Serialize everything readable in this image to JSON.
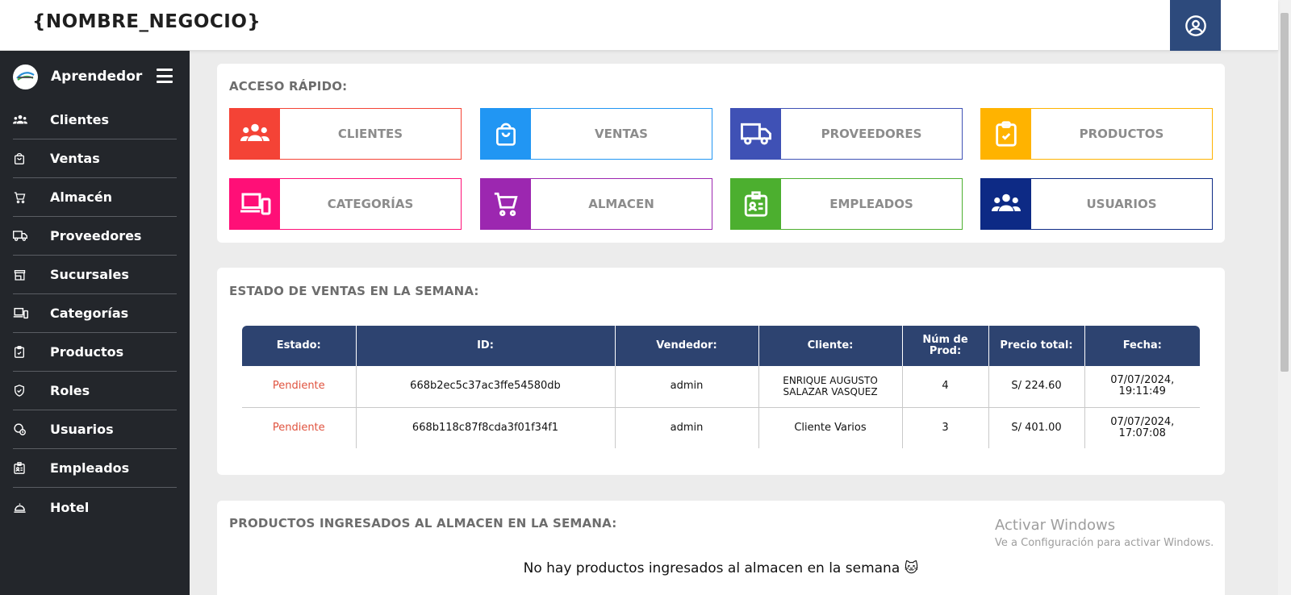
{
  "header": {
    "brand": "{NOMBRE_NEGOCIO}",
    "user_icon": "user-circle-icon"
  },
  "sidebar": {
    "title": "Aprendedor",
    "items": [
      {
        "label": "Clientes",
        "icon": "people-icon"
      },
      {
        "label": "Ventas",
        "icon": "shopping-bag-icon"
      },
      {
        "label": "Almacén",
        "icon": "cart-icon"
      },
      {
        "label": "Proveedores",
        "icon": "truck-icon"
      },
      {
        "label": "Sucursales",
        "icon": "store-icon"
      },
      {
        "label": "Categorías",
        "icon": "devices-icon"
      },
      {
        "label": "Productos",
        "icon": "clipboard-check-icon"
      },
      {
        "label": "Roles",
        "icon": "shield-check-icon"
      },
      {
        "label": "Usuarios",
        "icon": "user-clock-icon"
      },
      {
        "label": "Empleados",
        "icon": "badge-icon"
      },
      {
        "label": "Hotel",
        "icon": "bell-service-icon"
      }
    ]
  },
  "quick_access": {
    "title": "ACCESO RÁPIDO:",
    "tiles": [
      {
        "label": "CLIENTES",
        "color": "#f44336",
        "icon": "people-icon"
      },
      {
        "label": "VENTAS",
        "color": "#2196f3",
        "icon": "shopping-bag-icon"
      },
      {
        "label": "PROVEEDORES",
        "color": "#3f51b5",
        "icon": "truck-icon"
      },
      {
        "label": "PRODUCTOS",
        "color": "#ffb300",
        "icon": "clipboard-check-icon"
      },
      {
        "label": "CATEGORÍAS",
        "color": "#ff0f77",
        "icon": "devices-icon"
      },
      {
        "label": "ALMACEN",
        "color": "#9c27b0",
        "icon": "cart-icon"
      },
      {
        "label": "EMPLEADOS",
        "color": "#4caf2f",
        "icon": "badge-icon"
      },
      {
        "label": "USUARIOS",
        "color": "#0d2a85",
        "icon": "people-icon"
      }
    ]
  },
  "sales": {
    "title": "ESTADO DE VENTAS EN LA SEMANA:",
    "headers": [
      "Estado:",
      "ID:",
      "Vendedor:",
      "Cliente:",
      "Núm de Prod:",
      "Precio total:",
      "Fecha:"
    ],
    "rows": [
      [
        "Pendiente",
        "668b2ec5c37ac3ffe54580db",
        "admin",
        "ENRIQUE AUGUSTO SALAZAR VASQUEZ",
        "4",
        "S/ 224.60",
        "07/07/2024, 19:11:49"
      ],
      [
        "Pendiente",
        "668b118c87f8cda3f01f34f1",
        "admin",
        "Cliente Varios",
        "3",
        "S/ 401.00",
        "07/07/2024, 17:07:08"
      ]
    ]
  },
  "warehouse": {
    "title": "PRODUCTOS INGRESADOS AL ALMACEN EN LA SEMANA:",
    "empty_message": "No hay productos ingresados al almacen en la semana 🐱"
  },
  "watermark": {
    "line1": "Activar Windows",
    "line2": "Ve a Configuración para activar Windows."
  }
}
